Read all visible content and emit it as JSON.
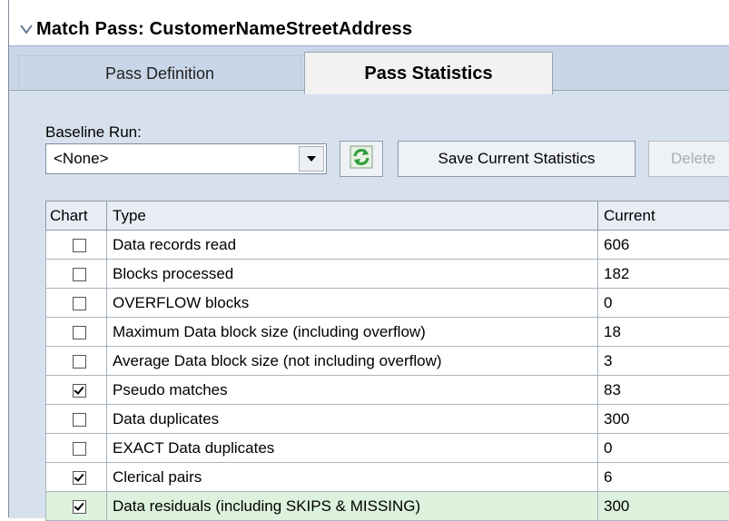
{
  "window": {
    "title": "Match Pass: CustomerNameStreetAddress",
    "collapse_icon": "chevron-down-icon"
  },
  "tabs": [
    {
      "label": "Pass Definition",
      "active": false
    },
    {
      "label": "Pass Statistics",
      "active": true
    }
  ],
  "baseline": {
    "label": "Baseline Run:",
    "selected": "<None>",
    "dropdown_icon": "dropdown-arrow-icon"
  },
  "toolbar": {
    "refresh_icon": "refresh-icon",
    "save_label": "Save Current Statistics",
    "delete_label": "Delete"
  },
  "table": {
    "columns": [
      "Chart",
      "Type",
      "Current"
    ],
    "rows": [
      {
        "checked": false,
        "type": "Data records read",
        "current": "606"
      },
      {
        "checked": false,
        "type": "Blocks processed",
        "current": "182"
      },
      {
        "checked": false,
        "type": "OVERFLOW blocks",
        "current": "0"
      },
      {
        "checked": false,
        "type": "Maximum Data block size (including overflow)",
        "current": "18"
      },
      {
        "checked": false,
        "type": "Average Data block size (not including overflow)",
        "current": "3"
      },
      {
        "checked": true,
        "type": "Pseudo matches",
        "current": "83"
      },
      {
        "checked": false,
        "type": "Data duplicates",
        "current": "300"
      },
      {
        "checked": false,
        "type": "EXACT Data duplicates",
        "current": "0"
      },
      {
        "checked": true,
        "type": "Clerical pairs",
        "current": "6"
      },
      {
        "checked": true,
        "type": "Data residuals (including SKIPS & MISSING)",
        "current": "300"
      }
    ]
  },
  "colors": {
    "tab_strip": "#c9d6e8",
    "panel": "#d7e1ee",
    "highlight_row": "#dcf2dc",
    "refresh_green": "#2e9e3a"
  }
}
